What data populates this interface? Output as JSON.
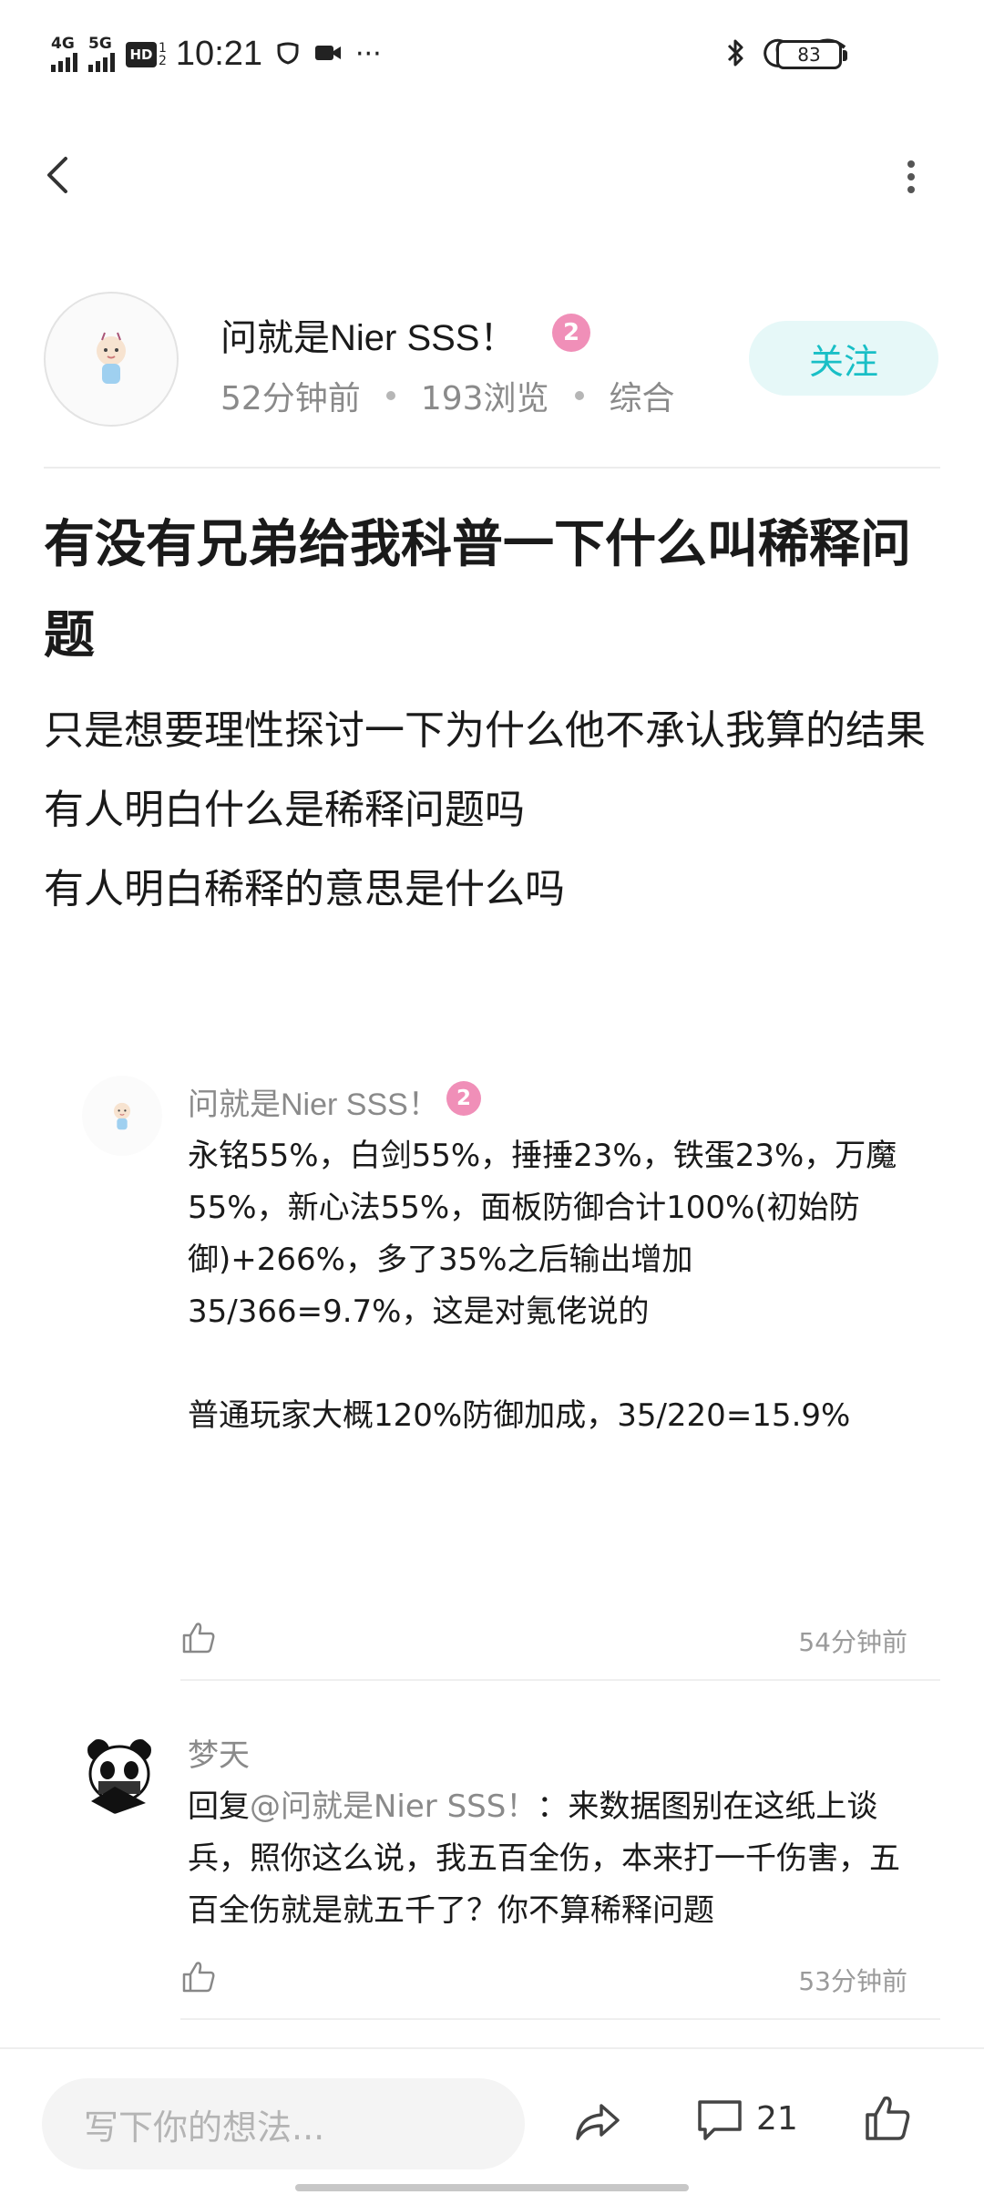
{
  "status_bar": {
    "network_1": "4G",
    "network_2": "5G",
    "hd_label": "HD",
    "hd_sub_1": "1",
    "hd_sub_2": "2",
    "time": "10:21",
    "more": "···",
    "battery": "83",
    "icons": [
      "signal-icon",
      "hd-icon",
      "shield-icon",
      "video-icon",
      "bluetooth-icon",
      "moon-icon",
      "wifi-icon",
      "battery-icon"
    ]
  },
  "nav": {
    "back_icon": "chevron-left-icon",
    "more_icon": "more-vertical-icon"
  },
  "author": {
    "name": "问就是Nier SSS！",
    "level": "2",
    "time_ago": "52分钟前",
    "views": "193浏览",
    "category": "综合",
    "follow_label": "关注"
  },
  "post": {
    "title": "有没有兄弟给我科普一下什么叫稀释问题",
    "body": [
      "只是想要理性探讨一下为什么他不承认我算的结果",
      "有人明白什么是稀释问题吗",
      "有人明白稀释的意思是什么吗"
    ]
  },
  "comments": [
    {
      "name": "问就是Nier SSS！",
      "level": "2",
      "text": "永铭55%，白剑55%，捶捶23%，铁蛋23%，万魔55%，新心法55%，面板防御合计100%(初始防御)+266%，多了35%之后输出增加35/366=9.7%，这是对氪佬说的\n\n普通玩家大概120%防御加成，35/220=15.9%",
      "time": "54分钟前"
    },
    {
      "name": "梦天",
      "mention": "@问就是Nier SSS！",
      "reply_prefix": "回复",
      "text": "：来数据图别在这纸上谈兵，照你这么说，我五百全伤，本来打一千伤害，五百全伤就是就五千了？你不算稀释问题",
      "time": "53分钟前"
    }
  ],
  "bottom_bar": {
    "input_placeholder": "写下你的想法...",
    "comment_count": "21",
    "icons": [
      "share-icon",
      "comment-icon",
      "thumbs-up-icon"
    ]
  },
  "colors": {
    "accent": "#19bfc6",
    "follow_bg": "#e6f8f8",
    "badge": "#f08fb8",
    "meta_text": "#8a8a8a"
  }
}
